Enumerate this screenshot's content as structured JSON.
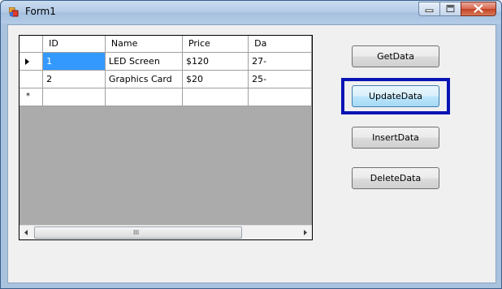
{
  "window": {
    "title": "Form1",
    "icon": "form-icon",
    "controls": [
      "minimize-icon",
      "maximize-icon",
      "close-icon"
    ]
  },
  "grid": {
    "columns": [
      "ID",
      "Name",
      "Price",
      "Da"
    ],
    "rows": [
      {
        "id": "1",
        "name": "LED Screen",
        "price": "$120",
        "date": "27-"
      },
      {
        "id": "2",
        "name": "Graphics Card",
        "price": "$20",
        "date": "25-"
      }
    ],
    "selected_cell": {
      "row": 0,
      "column": "ID"
    },
    "new_row_marker": "*",
    "scroll_grip": "III"
  },
  "buttons": {
    "get": "GetData",
    "update": "UpdateData",
    "insert": "InsertData",
    "delete": "DeleteData"
  },
  "colors": {
    "selection": "#3399ff",
    "highlight_border": "#0a14b4",
    "grid_background": "#ababab"
  }
}
